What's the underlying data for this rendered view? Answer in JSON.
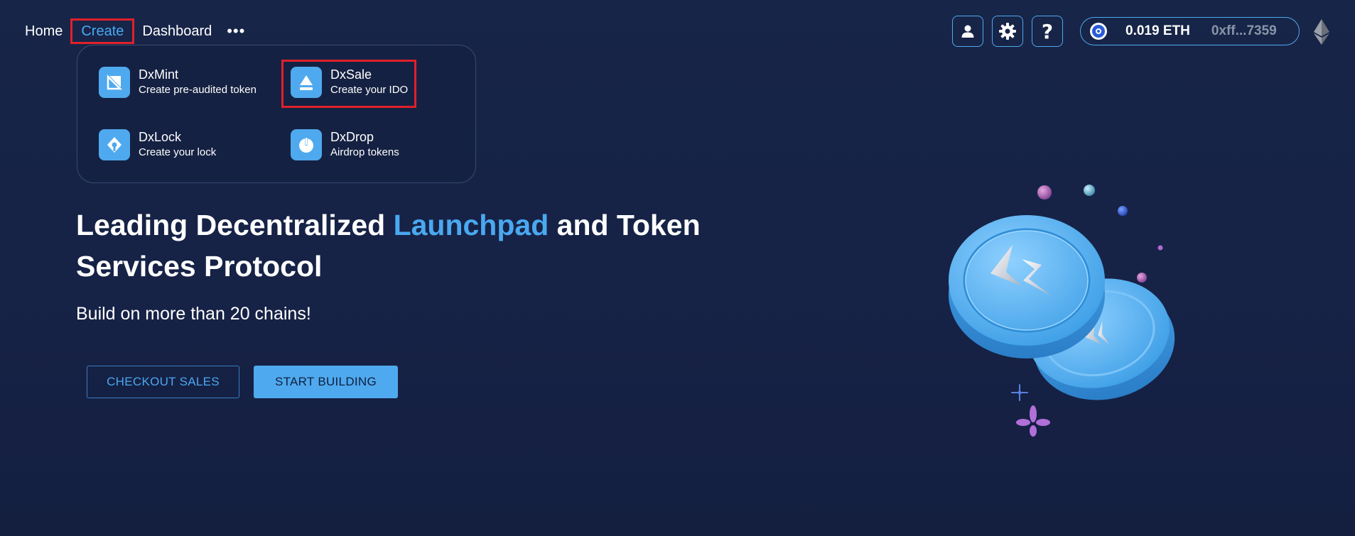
{
  "nav": {
    "home": "Home",
    "create": "Create",
    "dashboard": "Dashboard",
    "more": "•••"
  },
  "dropdown": {
    "items": [
      {
        "title": "DxMint",
        "subtitle": "Create pre-audited token",
        "icon": "mint-icon"
      },
      {
        "title": "DxSale",
        "subtitle": "Create your IDO",
        "icon": "sale-icon"
      },
      {
        "title": "DxLock",
        "subtitle": "Create your lock",
        "icon": "lock-icon"
      },
      {
        "title": "DxDrop",
        "subtitle": "Airdrop tokens",
        "icon": "drop-icon"
      }
    ]
  },
  "hero": {
    "title_part1": "Leading Decentralized ",
    "title_accent": "Launchpad",
    "title_part2": " and Token Services Protocol",
    "subtitle": "Build on more than 20 chains!",
    "btn_checkout": "CHECKOUT SALES",
    "btn_start": "START BUILDING"
  },
  "topbar": {
    "account_icon": "user-icon",
    "settings_icon": "gear-icon",
    "help_icon": "question-icon",
    "help_glyph": "?",
    "wallet_balance": "0.019 ETH",
    "wallet_address": "0xff...7359",
    "network_icon": "ethereum-icon"
  },
  "colors": {
    "background": "#172548",
    "accent": "#4aa8f0",
    "highlight": "#e0202a"
  }
}
